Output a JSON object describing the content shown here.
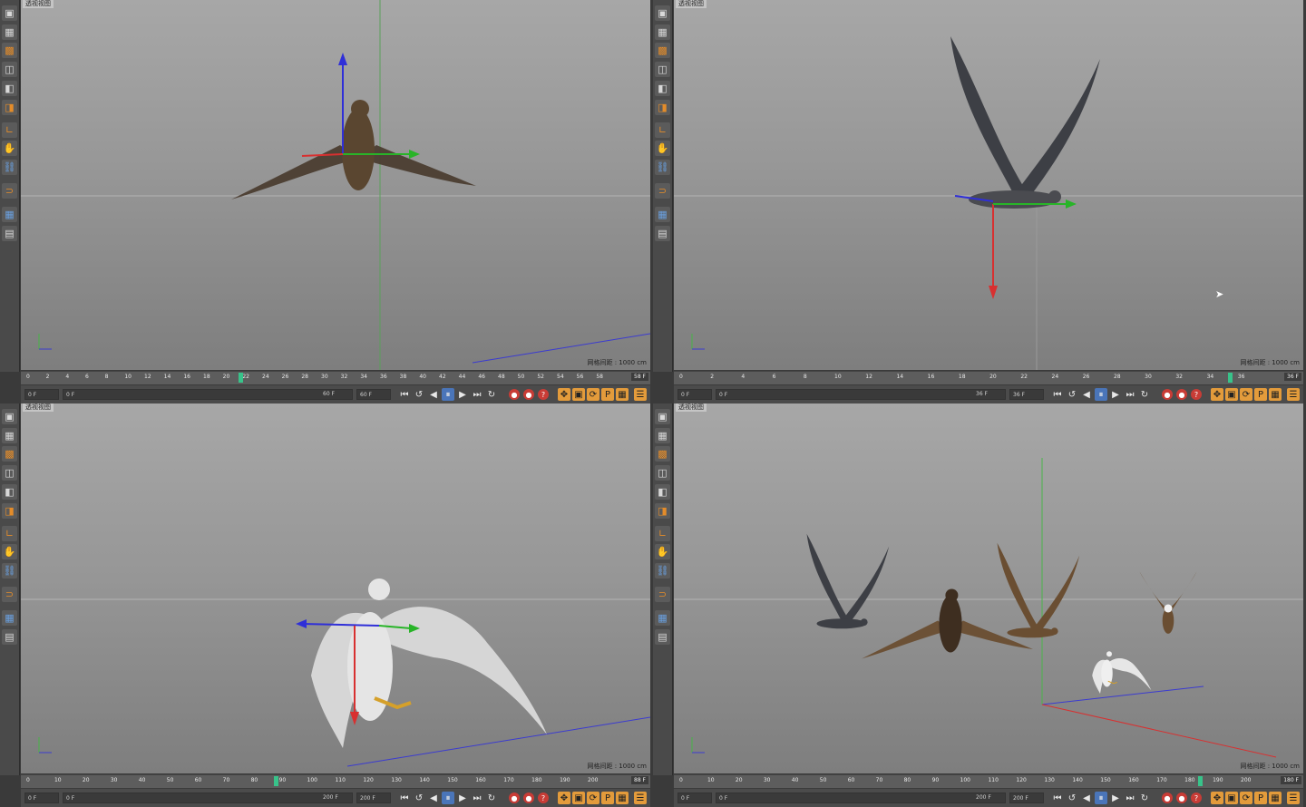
{
  "colors": {
    "accent": "#4a75b9",
    "record": "#c83c36",
    "marker": "#38c38a",
    "key": "#e39b3b"
  },
  "viewports": [
    {
      "title": "透视视图",
      "status": "网格间距 : 1000 cm",
      "timeline_ticks": [
        "0",
        "2",
        "4",
        "6",
        "8",
        "10",
        "12",
        "14",
        "16",
        "18",
        "20",
        "22",
        "24",
        "26",
        "28",
        "30",
        "32",
        "34",
        "36",
        "38",
        "40",
        "42",
        "44",
        "46",
        "48",
        "50",
        "52",
        "54",
        "56",
        "58"
      ],
      "current_frame": "58 F",
      "playhead_fraction": 0.36,
      "start_field": "0 F",
      "preview_start": "0 F",
      "preview_end": "60 F",
      "end_field": "60 F",
      "wing_color": "#4b3d30",
      "body_color": "#5a4630"
    },
    {
      "title": "透视视图",
      "status": "网格间距 : 1000 cm",
      "timeline_ticks": [
        "0",
        "2",
        "4",
        "6",
        "8",
        "10",
        "12",
        "14",
        "16",
        "18",
        "20",
        "22",
        "24",
        "26",
        "28",
        "30",
        "32",
        "34",
        "36"
      ],
      "current_frame": "36 F",
      "playhead_fraction": 0.93,
      "start_field": "0 F",
      "preview_start": "0 F",
      "preview_end": "36 F",
      "end_field": "36 F",
      "wing_color": "#3d3f45",
      "body_color": "#4a4b50"
    },
    {
      "title": "透视视图",
      "status": "网格间距 : 1000 cm",
      "timeline_ticks": [
        "0",
        "10",
        "20",
        "30",
        "40",
        "50",
        "60",
        "70",
        "80",
        "90",
        "100",
        "110",
        "120",
        "130",
        "140",
        "150",
        "160",
        "170",
        "180",
        "190",
        "200"
      ],
      "current_frame": "88 F",
      "playhead_fraction": 0.42,
      "start_field": "0 F",
      "preview_start": "0 F",
      "preview_end": "200 F",
      "end_field": "200 F",
      "wing_color": "#d6d6d6",
      "body_color": "#e5e5e5"
    },
    {
      "title": "透视视图",
      "status": "网格间距 : 1000 cm",
      "timeline_ticks": [
        "0",
        "10",
        "20",
        "30",
        "40",
        "50",
        "60",
        "70",
        "80",
        "90",
        "100",
        "110",
        "120",
        "130",
        "140",
        "150",
        "160",
        "170",
        "180",
        "190",
        "200"
      ],
      "current_frame": "180 F",
      "playhead_fraction": 0.88,
      "start_field": "0 F",
      "preview_start": "0 F",
      "preview_end": "200 F",
      "end_field": "200 F",
      "wing_color": "#3d3f45",
      "body_color": "#6a4e32"
    }
  ],
  "toolbar_icons": [
    "cube-icon",
    "checker-cube-icon",
    "hatch-cube-icon",
    "box-icon",
    "box-outline-icon",
    "box-orange-icon",
    "angle-icon",
    "hand-icon",
    "link-icon",
    "magnet-icon",
    "grid-icon",
    "grid-lock-icon"
  ],
  "transport_buttons": [
    "go-to-start",
    "record-key",
    "previous-frame",
    "pause",
    "next-frame",
    "go-to-end",
    "loop"
  ],
  "key_buttons": [
    "record-keys",
    "auto-key",
    "help-key"
  ],
  "mode_buttons": [
    "move-mode",
    "scale-mode",
    "rotate-mode",
    "param-mode",
    "grid-mode"
  ]
}
